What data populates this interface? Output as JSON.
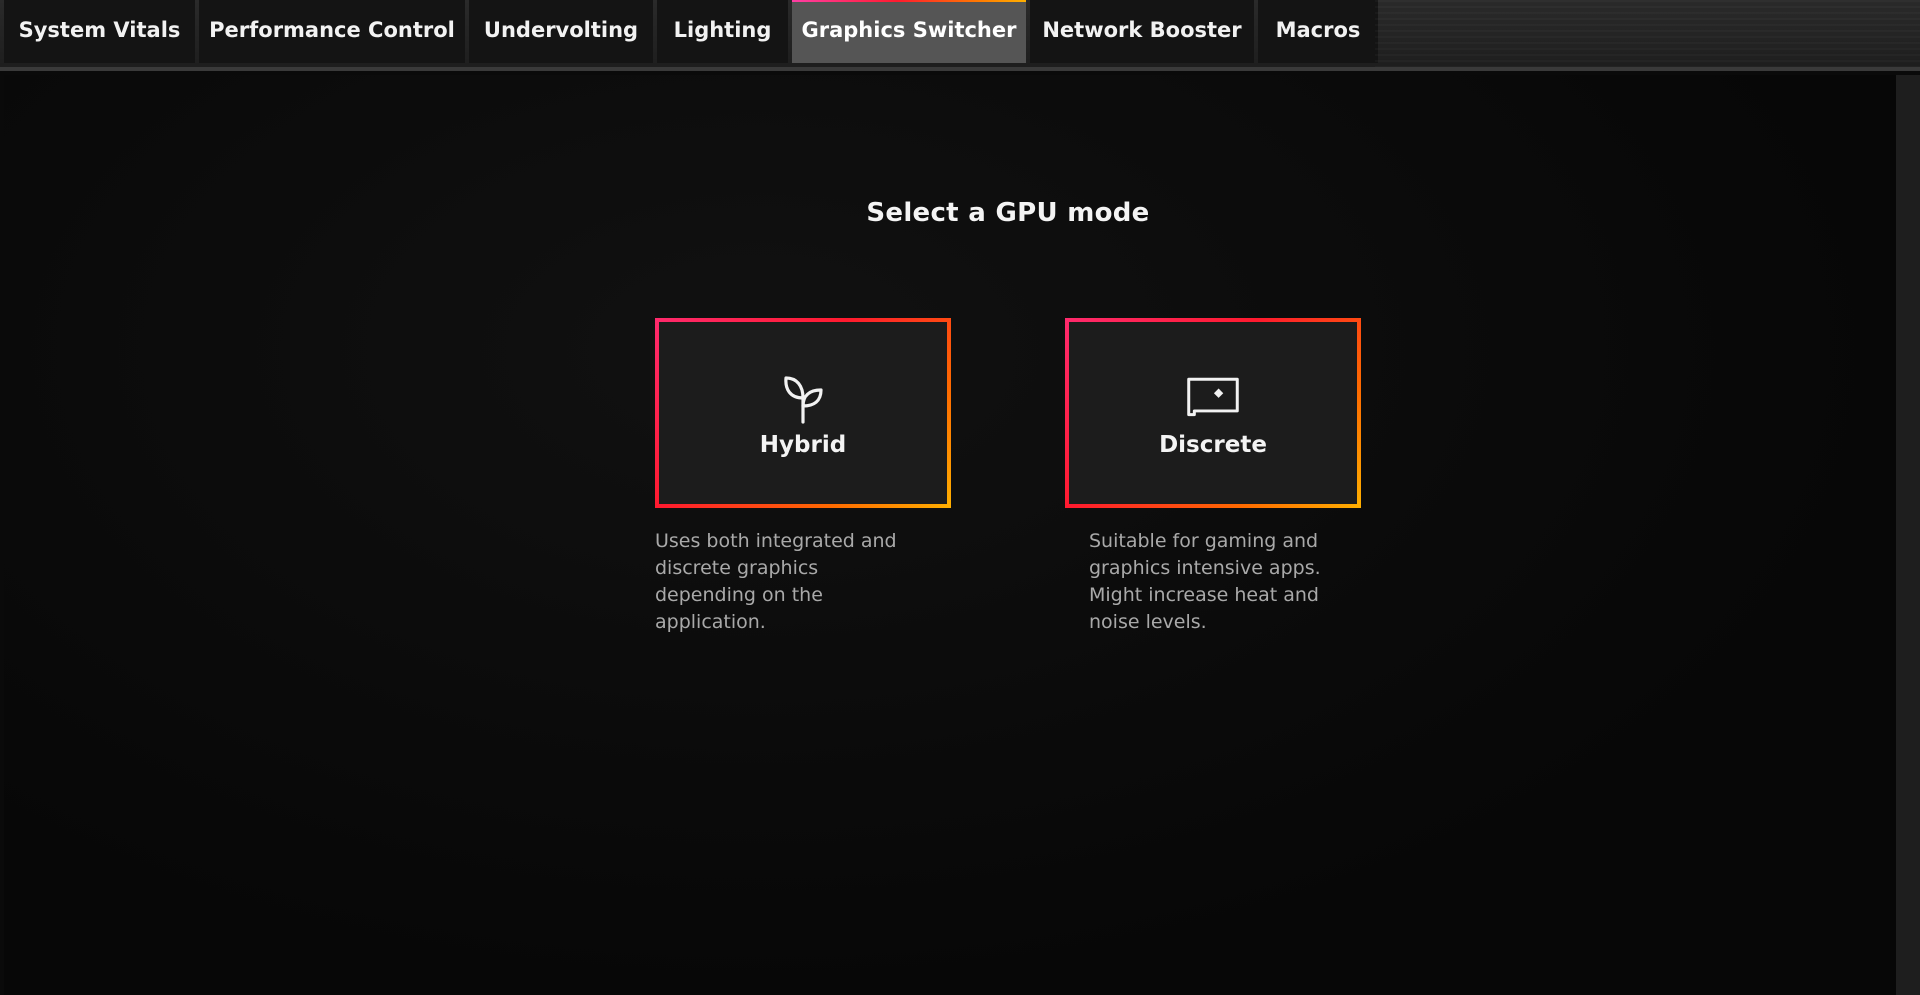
{
  "tabs": [
    {
      "label": "System Vitals",
      "active": false
    },
    {
      "label": "Performance Control",
      "active": false
    },
    {
      "label": "Undervolting",
      "active": false
    },
    {
      "label": "Lighting",
      "active": false
    },
    {
      "label": "Graphics Switcher",
      "active": true
    },
    {
      "label": "Network Booster",
      "active": false
    },
    {
      "label": "Macros",
      "active": false
    }
  ],
  "main": {
    "title": "Select a GPU mode",
    "modes": [
      {
        "label": "Hybrid",
        "icon": "sprout-icon",
        "description": "Uses both integrated and discrete graphics depending on the application."
      },
      {
        "label": "Discrete",
        "icon": "monitor-icon",
        "description": "Suitable for gaming and graphics intensive apps. Might increase heat and noise levels."
      }
    ]
  },
  "colors": {
    "accent_pink": "#ff2a6d",
    "accent_red": "#ff1a2e",
    "accent_orange": "#ff6a00",
    "accent_yellow": "#ffb000",
    "active_tab": "#555555",
    "background": "#0a0a0a"
  }
}
